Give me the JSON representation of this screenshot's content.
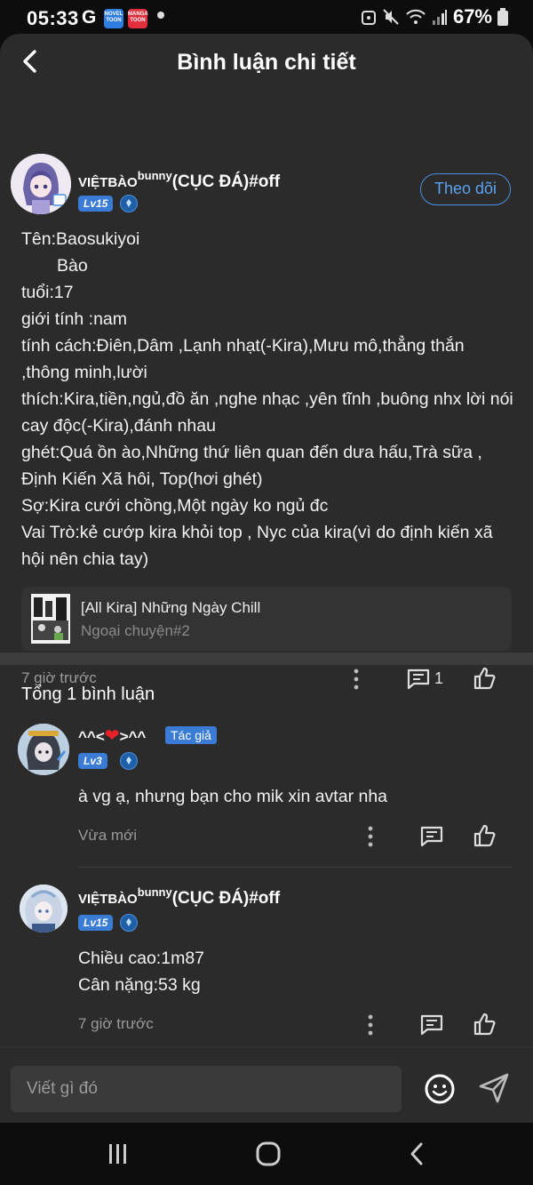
{
  "status_bar": {
    "time": "05:33",
    "g_label": "G",
    "novel_icon_text": "NOVEL TOON",
    "manga_icon_text": "MANGA TOON",
    "battery": "67%"
  },
  "header": {
    "title": "Bình luận chi tiết"
  },
  "post": {
    "username_main": "VIỆTBÀO",
    "username_sup": "bunny",
    "username_tail": "(CỤC ĐÁ)#off",
    "level": "Lv15",
    "follow_label": "Theo dõi",
    "lines": [
      "Tên:Baosukiyoi",
      "Bào",
      "tuổi:17",
      "giới tính :nam",
      "tính cách:Điên,Dâm ,Lạnh nhạt(-Kira),Mưu mô,thẳng thắn ,thông minh,lười",
      "thích:Kira,tiền,ngủ,đồ ăn ,nghe nhạc ,yên tĩnh ,buông nhx lời nói cay độc(-Kira),đánh nhau",
      "ghét:Quá ồn ào,Những thứ liên quan đến dưa hấu,Trà sữa , Định Kiến Xã hôi, Top(hơi ghét)",
      "Sợ:Kira cưới chồng,Một ngày ko ngủ đc",
      "Vai Trò:kẻ cướp kira khỏi top , Nyc của kira(vì do định kiến xã hội nên chia tay)"
    ],
    "ref_title": "[All Kira] Những Ngày Chill",
    "ref_subtitle": "Ngoại chuyện#2",
    "time": "7 giờ trước",
    "comment_count": "1"
  },
  "comments_header": "Tổng 1 bình luận",
  "comments": [
    {
      "username_left": "^^<",
      "username_right": ">^^",
      "author_tag": "Tác giả",
      "level": "Lv3",
      "lines": [
        "à vg ạ, nhưng bạn cho mik xin avtar nha"
      ],
      "time": "Vừa mới"
    },
    {
      "username_main": "VIỆTBÀO",
      "username_sup": "bunny",
      "username_tail": "(CỤC ĐÁ)#off",
      "level": "Lv15",
      "lines": [
        "Chiều cao:1m87",
        "Cân nặng:53 kg"
      ],
      "time": "7 giờ trước"
    }
  ],
  "input": {
    "placeholder": "Viết gì đó"
  },
  "colors": {
    "background": "#2b2b2b",
    "accent": "#4a90e2",
    "badge": "#3a7bd5"
  }
}
